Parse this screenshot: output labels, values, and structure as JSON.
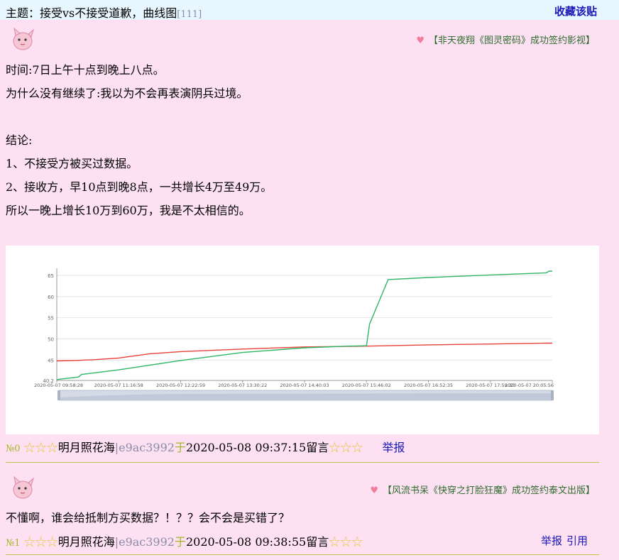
{
  "thread": {
    "topic_label": "主题：",
    "topic_title": "接受vs不接受道歉，曲线图",
    "reply_count": "[111]",
    "favorite_label": "收藏该贴"
  },
  "posts": [
    {
      "signature": "【非天夜翔《图灵密码》成功签约影视】",
      "lines": [
        "时间:7日上午十点到晚上八点。",
        "为什么没有继续了:我以为不会再表演阴兵过境。",
        "",
        "结论:",
        "1、不接受方被买过数据。",
        "2、接收方，早10点到晚8点，一共增长4万至49万。",
        "所以一晚上增长10万到60万，我是不太相信的。"
      ],
      "number": "№0",
      "stars_before": "☆☆☆",
      "author": "明月照花海",
      "hash": "|e9ac3992",
      "yu": "于",
      "timestamp": "2020-05-08 09:37:15",
      "liuyan": "留言",
      "stars_after": "☆☆☆",
      "report_label": "举报"
    },
    {
      "signature": "【风流书呆《快穿之打脸狂魔》成功签约泰文出版】",
      "lines": [
        "不懂啊，谁会给抵制方买数据？！？？会不会是买错了？"
      ],
      "number": "№1",
      "stars_before": "☆☆☆",
      "author": "明月照花海",
      "hash": "|e9ac3992",
      "yu": "于",
      "timestamp": "2020-05-08 09:38:55",
      "liuyan": "留言",
      "stars_after": "☆☆☆",
      "report_label": "举报",
      "quote_label": "引用"
    }
  ],
  "colors": {
    "background": "#fde1f2",
    "topbar": "#e8f6ff",
    "link": "#1818b8",
    "red_series": "#e8413a",
    "green_series": "#2fb566"
  },
  "chart_data": {
    "type": "line",
    "x_tick_labels": [
      "2020-05-07 09:58:28",
      "2020-05-07 11:16:58",
      "2020-05-07 12:22:59",
      "2020-05-07 13:30:22",
      "2020-05-07 14:40:03",
      "2020-05-07 15:46:02",
      "2020-05-07 16:52:35",
      "2020-05-07 17:59:33",
      "2020-05-07 20:05:56"
    ],
    "y_ticks": [
      40.2,
      45,
      50,
      55,
      60,
      65
    ],
    "ylim": [
      40.2,
      66
    ],
    "grid": true,
    "series": [
      {
        "color": "#e8413a",
        "x": [
          0,
          0.3,
          0.6,
          1.0,
          1.5,
          2.0,
          3.0,
          4.0,
          5.0,
          6.0,
          7.0,
          7.9,
          8.0
        ],
        "y": [
          44.8,
          44.9,
          45.1,
          45.5,
          46.5,
          47.0,
          47.6,
          48.1,
          48.3,
          48.6,
          48.8,
          49.0,
          49.0
        ]
      },
      {
        "color": "#2fb566",
        "x": [
          0,
          0.35,
          0.4,
          1.0,
          2.0,
          3.0,
          4.0,
          4.7,
          5.0,
          5.05,
          5.35,
          6.0,
          7.0,
          7.9,
          7.95,
          8.0
        ],
        "y": [
          40.4,
          41.0,
          41.6,
          42.7,
          44.9,
          46.8,
          47.9,
          48.3,
          48.4,
          53.5,
          64.0,
          64.5,
          65.1,
          65.6,
          66.0,
          66.0
        ]
      }
    ]
  }
}
